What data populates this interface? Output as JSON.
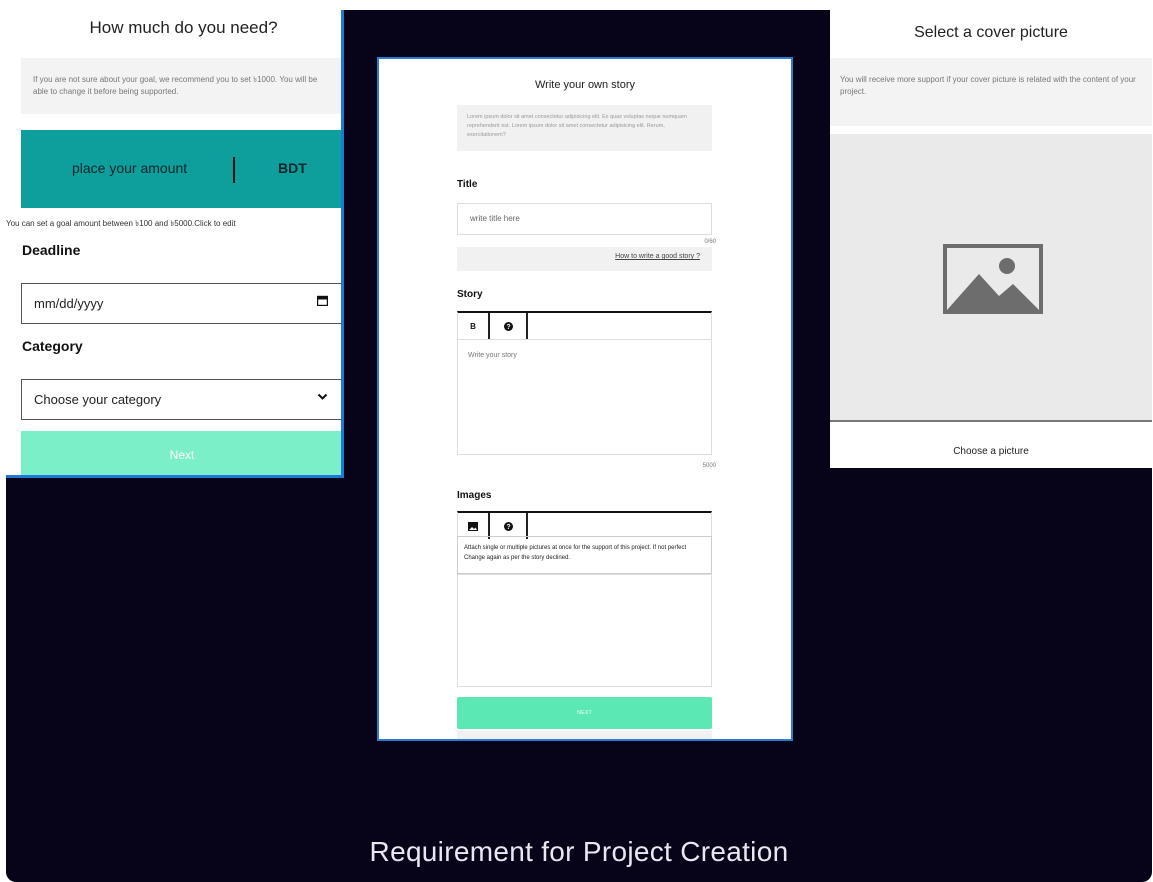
{
  "caption": "Requirement for Project Creation",
  "left_panel": {
    "title": "How much do you need?",
    "note": "If you are not sure about your goal, we recommend you to set ৳1000. You will be able to change it before being supported.",
    "amount_placeholder": "place your amount",
    "currency": "BDT",
    "hint": "You can set a goal amount between ৳100 and ৳5000.Click to edit",
    "deadline_label": "Deadline",
    "date_placeholder": "mm/dd/yyyy",
    "category_label": "Category",
    "category_value": "Choose your category",
    "next_label": "Next"
  },
  "center_panel": {
    "title": "Write your own story",
    "lorem": "Lorem ipsum dolor sit amet consectetur adipisicing elit. Ex quas voluptas neque numquam reprehenderit est. Lorem ipsum dolor sit amet consectetur adipisicing elit. Rerum, exercitationem?",
    "title_label": "Title",
    "title_placeholder": "write title here",
    "title_counter": "0/60",
    "howto_link": "How to write a good story ?",
    "story_label": "Story",
    "bold_button": "B",
    "help_glyph": "?",
    "story_placeholder": "Write your story",
    "story_counter": "5000",
    "images_label": "Images",
    "images_description": "Attach single or multiple pictures at once for the support of this project. If not perfect Change again as per the story declined.",
    "next_label": "NEXT"
  },
  "right_panel": {
    "title": "Select a cover picture",
    "note": "You will receive more support if your cover picture is related with the content of your project.",
    "choose_label": "Choose a picture"
  },
  "colors": {
    "stage_bg": "#07041a",
    "accent_teal": "#0e9e9c",
    "mint_button": "#7aefc8",
    "panel_border": "#1f78d6"
  },
  "icons": {
    "calendar": "calendar-icon",
    "chevron": "chevron-down-icon",
    "image": "image-icon",
    "help": "help-icon",
    "placeholder_picture": "picture-placeholder-icon"
  }
}
